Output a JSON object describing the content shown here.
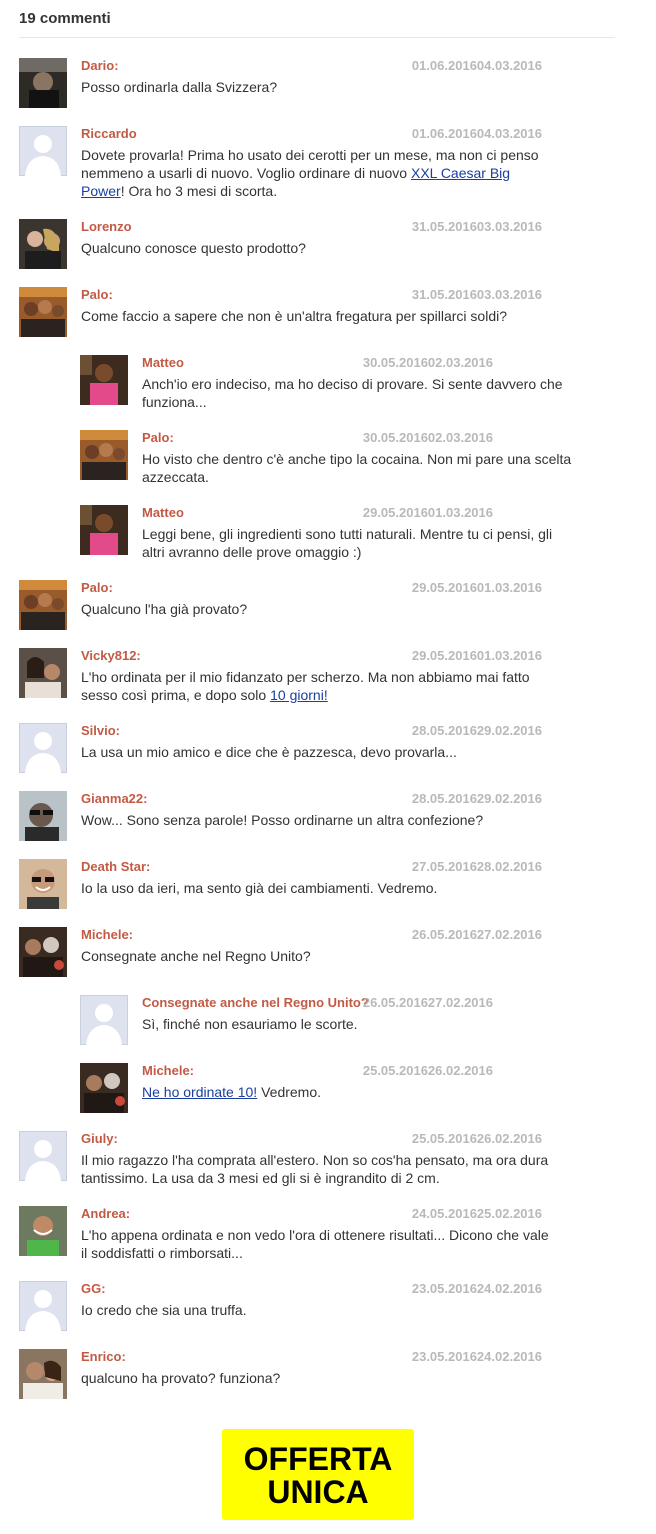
{
  "header": {
    "title": "19 commenti"
  },
  "comments": [
    {
      "name": "Dario:",
      "date": "01.06.201604.03.2016",
      "text": "Posso ordinarla dalla Svizzera?",
      "avatar": "dark"
    },
    {
      "name": "Riccardo",
      "date": "01.06.201604.03.2016",
      "text_before": "Dovete provarla! Prima ho usato dei cerotti per un mese, ma non ci penso nemmeno a usarli di nuovo. Voglio ordinare di nuovo ",
      "link": "XXL Caesar Big Power",
      "text_after": "! Ora ho 3 mesi di scorta.",
      "avatar": "placeholder"
    },
    {
      "name": "Lorenzo",
      "date": "31.05.201603.03.2016",
      "text": "Qualcuno conosce questo prodotto?",
      "avatar": "couple"
    },
    {
      "name": "Palo:",
      "date": "31.05.201603.03.2016",
      "text": "Come faccio a sapere che non è un'altra fregatura per spillarci soldi?",
      "avatar": "group"
    },
    {
      "name": "Matteo",
      "date": "30.05.201602.03.2016",
      "text": "Anch'io ero indeciso, ma ho deciso di provare. Si sente davvero che funziona...",
      "avatar": "pink"
    },
    {
      "name": "Palo:",
      "date": "30.05.201602.03.2016",
      "text": "Ho visto che dentro c'è anche tipo la cocaina. Non mi pare una scelta azzeccata.",
      "avatar": "group"
    },
    {
      "name": "Matteo",
      "date": "29.05.201601.03.2016",
      "text": "Leggi bene, gli ingredienti sono tutti naturali. Mentre tu ci pensi, gli altri avranno delle prove omaggio :)",
      "avatar": "pink"
    },
    {
      "name": "Palo:",
      "date": "29.05.201601.03.2016",
      "text": "Qualcuno l'ha già provato?",
      "avatar": "group"
    },
    {
      "name": "Vicky812:",
      "date": "29.05.201601.03.2016",
      "text_before": "L'ho ordinata per il mio fidanzato per scherzo. Ma non abbiamo mai fatto sesso così prima, e dopo solo ",
      "link": "10 giorni!",
      "text_after": "",
      "avatar": "couple2"
    },
    {
      "name": "Silvio:",
      "date": "28.05.201629.02.2016",
      "text": "La usa un mio amico e dice che è pazzesca, devo provarla...",
      "avatar": "placeholder"
    },
    {
      "name": "Gianma22:",
      "date": "28.05.201629.02.2016",
      "text": "Wow... Sono senza parole! Posso ordinarne un altra confezione?",
      "avatar": "sunglasses"
    },
    {
      "name": "Death Star:",
      "date": "27.05.201628.02.2016",
      "text": "Io la uso da ieri, ma sento già dei cambiamenti. Vedremo.",
      "avatar": "smile"
    },
    {
      "name": "Michele:",
      "date": "26.05.201627.02.2016",
      "text": "Consegnate anche nel Regno Unito?",
      "avatar": "crowd"
    },
    {
      "name": "Consegnate anche nel Regno Unito?",
      "date": "26.05.201627.02.2016",
      "text": "Sì, finché non esauriamo le scorte.",
      "avatar": "placeholder"
    },
    {
      "name": "Michele:",
      "date": "25.05.201626.02.2016",
      "text_before": "",
      "link": "Ne ho ordinate 10!",
      "text_after": " Vedremo.",
      "avatar": "crowd"
    },
    {
      "name": "Giuly:",
      "date": "25.05.201626.02.2016",
      "text": "Il mio ragazzo l'ha comprata all'estero. Non so cos'ha pensato, ma ora dura tantissimo. La usa da 3 mesi ed gli si è ingrandito di 2 cm.",
      "avatar": "placeholder"
    },
    {
      "name": "Andrea:",
      "date": "24.05.201625.02.2016",
      "text": "L'ho appena ordinata e non vedo l'ora di ottenere risultati... Dicono che vale il soddisfatti o rimborsati...",
      "avatar": "green"
    },
    {
      "name": "GG:",
      "date": "23.05.201624.02.2016",
      "text": "Io credo che sia una truffa.",
      "avatar": "placeholder"
    },
    {
      "name": "Enrico:",
      "date": "23.05.201624.02.2016",
      "text": "qualcuno ha provato? funziona?",
      "avatar": "couple3"
    }
  ],
  "cta": {
    "line1": "OFFERTA",
    "line2": "UNICA"
  }
}
